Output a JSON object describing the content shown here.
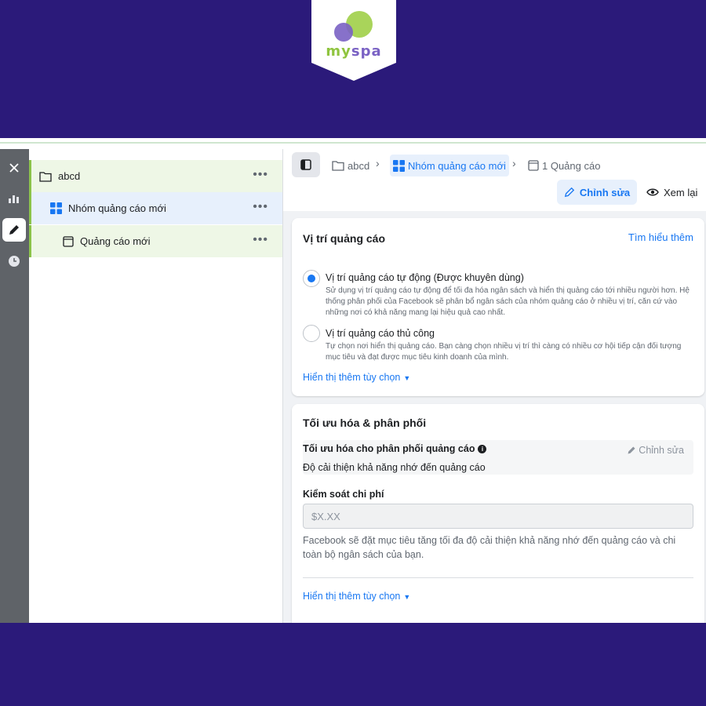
{
  "logo": {
    "text_my": "my",
    "text_spa": "spa",
    "colors": {
      "green": "#8fc43f",
      "purple": "#7a62c4",
      "background": "#2b1a7a"
    }
  },
  "rail": {
    "buttons": [
      {
        "icon": "close-icon"
      },
      {
        "icon": "bar-chart-icon"
      },
      {
        "icon": "pencil-icon",
        "active": true
      },
      {
        "icon": "clock-icon"
      }
    ]
  },
  "tree": {
    "campaign": {
      "label": "abcd",
      "icon": "folder-icon"
    },
    "adset": {
      "label": "Nhóm quảng cáo mới",
      "icon": "grid-icon"
    },
    "ad": {
      "label": "Quảng cáo mới",
      "icon": "ad-icon"
    },
    "more": "•••"
  },
  "header": {
    "breadcrumb": [
      {
        "label": "abcd",
        "icon": "folder-icon"
      },
      {
        "label": "Nhóm quảng cáo mới",
        "icon": "grid-icon"
      },
      {
        "label": "1 Quảng cáo",
        "icon": "ad-icon"
      }
    ],
    "separator": "›",
    "edit_label": "Chỉnh sửa",
    "review_label": "Xem lại"
  },
  "placement": {
    "title": "Vị trí quảng cáo",
    "learn_more": "Tìm hiểu thêm",
    "options": [
      {
        "title": "Vị trí quảng cáo tự động (Được khuyên dùng)",
        "desc": "Sử dụng vị trí quảng cáo tự động để tối đa hóa ngân sách và hiển thị quảng cáo tới nhiều người hơn. Hệ thống phân phối của Facebook sẽ phân bổ ngân sách của nhóm quảng cáo ở nhiều vị trí, căn cứ vào những nơi có khả năng mang lại hiệu quả cao nhất.",
        "selected": true
      },
      {
        "title": "Vị trí quảng cáo thủ công",
        "desc": "Tự chọn nơi hiển thị quảng cáo. Bạn càng chọn nhiều vị trí thì càng có nhiều cơ hội tiếp cận đối tượng mục tiêu và đạt được mục tiêu kinh doanh của mình.",
        "selected": false
      }
    ],
    "more_options": "Hiển thị thêm tùy chọn"
  },
  "optimization": {
    "title": "Tối ưu hóa & phân phối",
    "delivery_label": "Tối ưu hóa cho phân phối quảng cáo",
    "delivery_value": "Độ cải thiện khả năng nhớ đến quảng cáo",
    "edit_label": "Chỉnh sửa",
    "cost_label": "Kiểm soát chi phí",
    "cost_placeholder": "$X.XX",
    "cost_desc": "Facebook sẽ đặt mục tiêu tăng tối đa độ cải thiện khả năng nhớ đến quảng cáo và chi toàn bộ ngân sách của bạn.",
    "more_options": "Hiển thị thêm tùy chọn"
  }
}
